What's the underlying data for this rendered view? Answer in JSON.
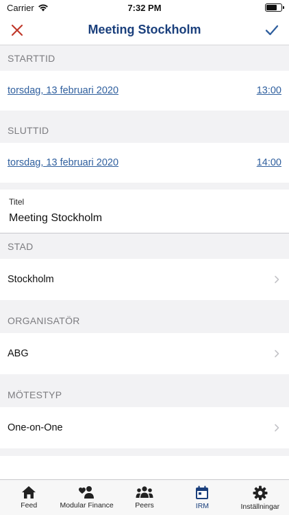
{
  "status_bar": {
    "carrier": "Carrier",
    "time": "7:32 PM"
  },
  "nav": {
    "title": "Meeting Stockholm",
    "cancel_icon": "close-icon",
    "save_icon": "checkmark-icon"
  },
  "start": {
    "header": "STARTTID",
    "date": "torsdag, 13 februari 2020",
    "time": "13:00"
  },
  "end": {
    "header": "SLUTTID",
    "date": "torsdag, 13 februari 2020",
    "time": "14:00"
  },
  "title_field": {
    "label": "Titel",
    "value": "Meeting Stockholm"
  },
  "city": {
    "header": "STAD",
    "value": "Stockholm"
  },
  "organizer": {
    "header": "ORGANISATÖR",
    "value": "ABG"
  },
  "meeting_type": {
    "header": "MÖTESTYP",
    "value": "One-on-One"
  },
  "tabs": [
    {
      "label": "Feed",
      "icon": "home-icon"
    },
    {
      "label": "Modular Finance",
      "icon": "people-heart-icon"
    },
    {
      "label": "Peers",
      "icon": "group-icon"
    },
    {
      "label": "IRM",
      "icon": "calendar-icon",
      "active": true
    },
    {
      "label": "Inställningar",
      "icon": "gear-icon"
    }
  ],
  "colors": {
    "accent": "#1a3f7c",
    "link": "#2f5f9e",
    "cancel": "#c0392b",
    "background": "#f2f2f4"
  }
}
